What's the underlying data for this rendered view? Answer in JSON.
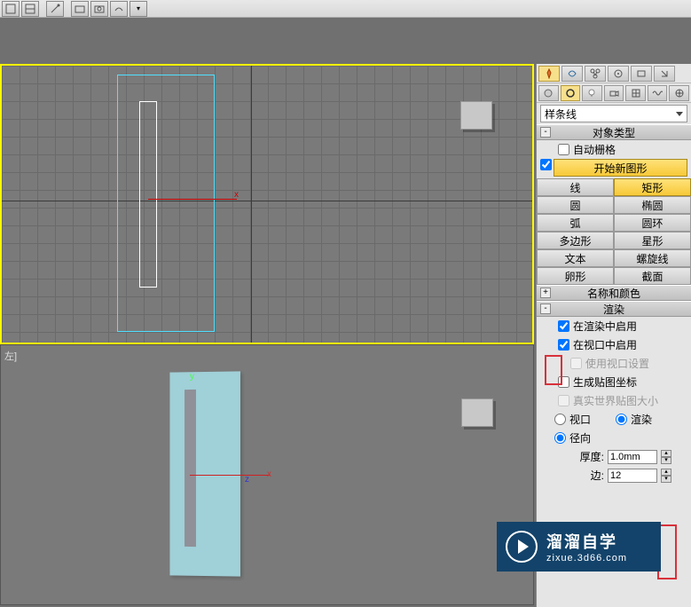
{
  "toolbar": {},
  "viewport": {
    "bottom_label": "左]",
    "x_label": "x",
    "y_label": "y",
    "z_label": "z",
    "x2_label": "x"
  },
  "panel": {
    "combo_label": "样条线",
    "roll_obj_type": "对象类型",
    "auto_grid": "自动栅格",
    "start_new_shape": "开始新图形",
    "buttons": {
      "line": "线",
      "rect": "矩形",
      "circle": "圆",
      "ellipse": "椭圆",
      "arc": "弧",
      "donut": "圆环",
      "poly": "多边形",
      "star": "星形",
      "text": "文本",
      "helix": "螺旋线",
      "egg": "卵形",
      "section": "截面"
    },
    "roll_name": "名称和颜色",
    "roll_render": "渲染",
    "enable_render": "在渲染中启用",
    "enable_viewport": "在视口中启用",
    "use_vp_settings": "使用视口设置",
    "gen_map_coords": "生成贴图坐标",
    "real_world": "真实世界贴图大小",
    "radio_vp": "视口",
    "radio_render": "渲染",
    "radial": "径向",
    "thickness_lbl": "厚度:",
    "thickness_val": "1.0mm",
    "sides_lbl": "边:",
    "sides_val": "12"
  },
  "watermark": {
    "line1": "溜溜自学",
    "line2": "zixue.3d66.com"
  }
}
